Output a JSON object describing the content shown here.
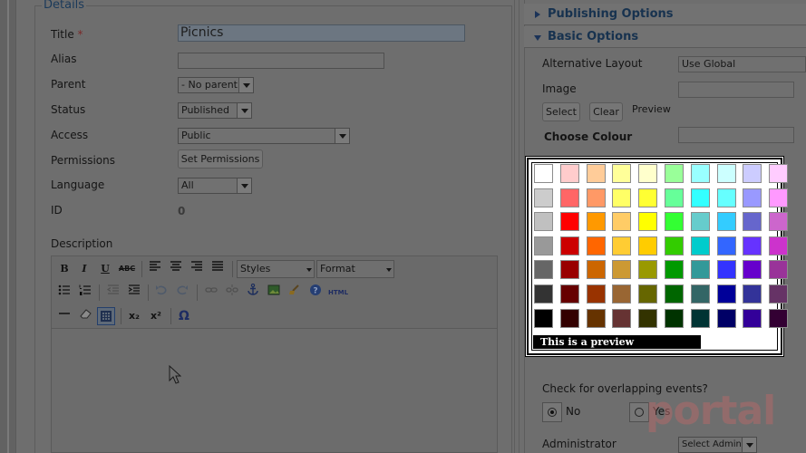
{
  "details": {
    "legend": "Details",
    "title_label": "Title",
    "required_mark": "*",
    "title_value": "Picnics",
    "alias_label": "Alias",
    "alias_value": "",
    "parent_label": "Parent",
    "parent_value": "- No parent -",
    "status_label": "Status",
    "status_value": "Published",
    "access_label": "Access",
    "access_value": "Public",
    "permissions_label": "Permissions",
    "permissions_button": "Set Permissions",
    "language_label": "Language",
    "language_value": "All",
    "id_label": "ID",
    "id_value": "0",
    "description_label": "Description"
  },
  "editor": {
    "bold": "B",
    "italic": "I",
    "underline": "U",
    "strike": "ABC",
    "styles": "Styles",
    "format": "Format",
    "html": "HTML",
    "omega": "Ω",
    "sub": "x₂",
    "sup": "x²"
  },
  "sidebar": {
    "publishing_options": "Publishing Options",
    "basic_options": "Basic Options",
    "alt_layout_label": "Alternative Layout",
    "alt_layout_value": "Use Global",
    "image_label": "Image",
    "select_button": "Select",
    "clear_button": "Clear",
    "preview_label": "Preview",
    "choose_colour_label": "Choose Colour",
    "overlap_label": "Check for overlapping events?",
    "no_label": "No",
    "yes_label": "Yes",
    "administrator_label": "Administrator",
    "administrator_value": "Select Admin"
  },
  "palette": {
    "preview_text": "This is a preview",
    "colors": [
      [
        "#ffffff",
        "#ffcccc",
        "#ffcc99",
        "#ffff99",
        "#ffffcc",
        "#99ff99",
        "#99ffff",
        "#ccffff",
        "#ccccff",
        "#ffccff"
      ],
      [
        "#cccccc",
        "#ff6666",
        "#ff9966",
        "#ffff66",
        "#ffff33",
        "#66ff99",
        "#33ffff",
        "#66ffff",
        "#9999ff",
        "#ff99ff"
      ],
      [
        "#c0c0c0",
        "#ff0000",
        "#ff9900",
        "#ffcc66",
        "#ffff00",
        "#33ff33",
        "#66cccc",
        "#33ccff",
        "#6666cc",
        "#cc66cc"
      ],
      [
        "#999999",
        "#cc0000",
        "#ff6600",
        "#ffcc33",
        "#ffcc00",
        "#33cc00",
        "#00cccc",
        "#3366ff",
        "#6633ff",
        "#cc33cc"
      ],
      [
        "#666666",
        "#990000",
        "#cc6600",
        "#cc9933",
        "#999900",
        "#009900",
        "#339999",
        "#3333ff",
        "#6600cc",
        "#993399"
      ],
      [
        "#333333",
        "#660000",
        "#993300",
        "#996633",
        "#666600",
        "#006600",
        "#336666",
        "#000099",
        "#333399",
        "#663366"
      ],
      [
        "#000000",
        "#330000",
        "#663300",
        "#663333",
        "#333300",
        "#003300",
        "#003333",
        "#000066",
        "#330099",
        "#330033"
      ]
    ]
  },
  "watermark": "portal"
}
